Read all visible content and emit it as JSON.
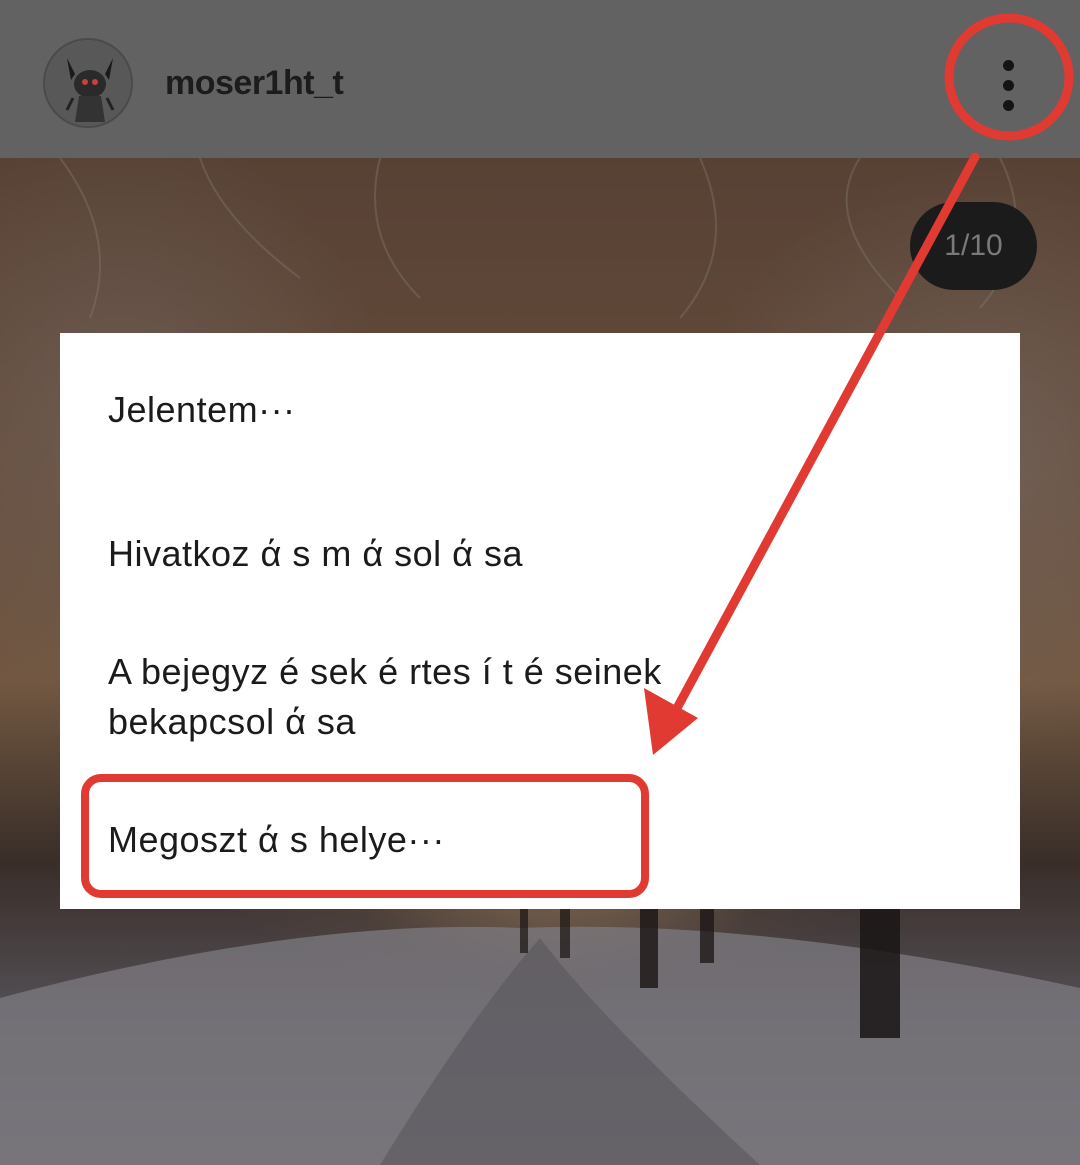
{
  "header": {
    "username": "moser1ht_t",
    "more_icon": "more-vertical-icon"
  },
  "counter": {
    "text": "1/10"
  },
  "menu": {
    "items": [
      {
        "label": "Jelentem···"
      },
      {
        "label": "Hivatkoz ά s  m ά sol ά sa"
      },
      {
        "label": "A  bejegyz é sek   é rtes  í  t é seinek bekapcsol ά sa"
      },
      {
        "label": "Megoszt ά s  helye···"
      }
    ]
  },
  "annotations": {
    "color": "#e03a33"
  }
}
